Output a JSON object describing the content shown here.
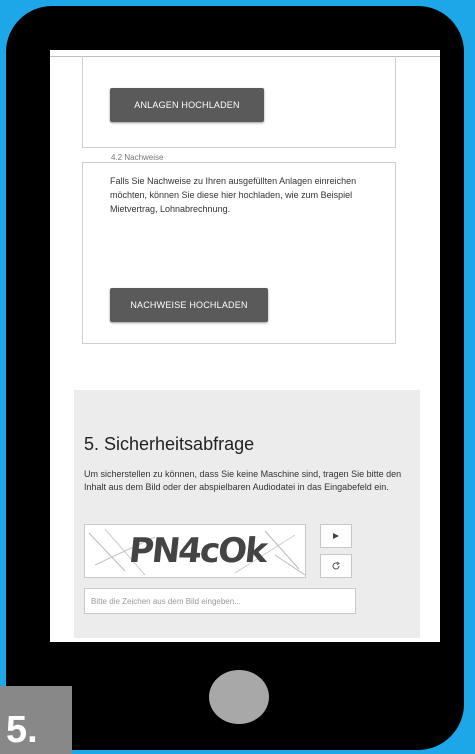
{
  "upload": {
    "anlagen_button": "ANLAGEN HOCHLADEN"
  },
  "nachweise": {
    "legend": "4.2 Nachweise",
    "text": "Falls Sie Nachweise zu Ihren ausgefüllten Anlagen einreichen möchten, können Sie diese hier hochladen, wie zum Beispiel Mietvertrag, Lohnabrechnung.",
    "button": "NACHWEISE HOCHLADEN"
  },
  "security": {
    "title": "5. Sicherheitsabfrage",
    "text": "Um sicherstellen zu können, dass Sie keine Maschine sind, tragen Sie bitte den Inhalt aus dem Bild oder der abspielbaren Audiodatei in das Eingabefeld ein.",
    "captcha_text": "PN4cOk",
    "audio_icon": "play-icon",
    "refresh_icon": "refresh-icon",
    "input_placeholder": "Bitte die Zeichen aus dem Bild eingeben..."
  },
  "step_badge": "5.",
  "colors": {
    "background": "#1ea7e8",
    "phone": "#000000",
    "button": "#5a5a5a",
    "panel": "#ececec",
    "badge": "#888888"
  }
}
